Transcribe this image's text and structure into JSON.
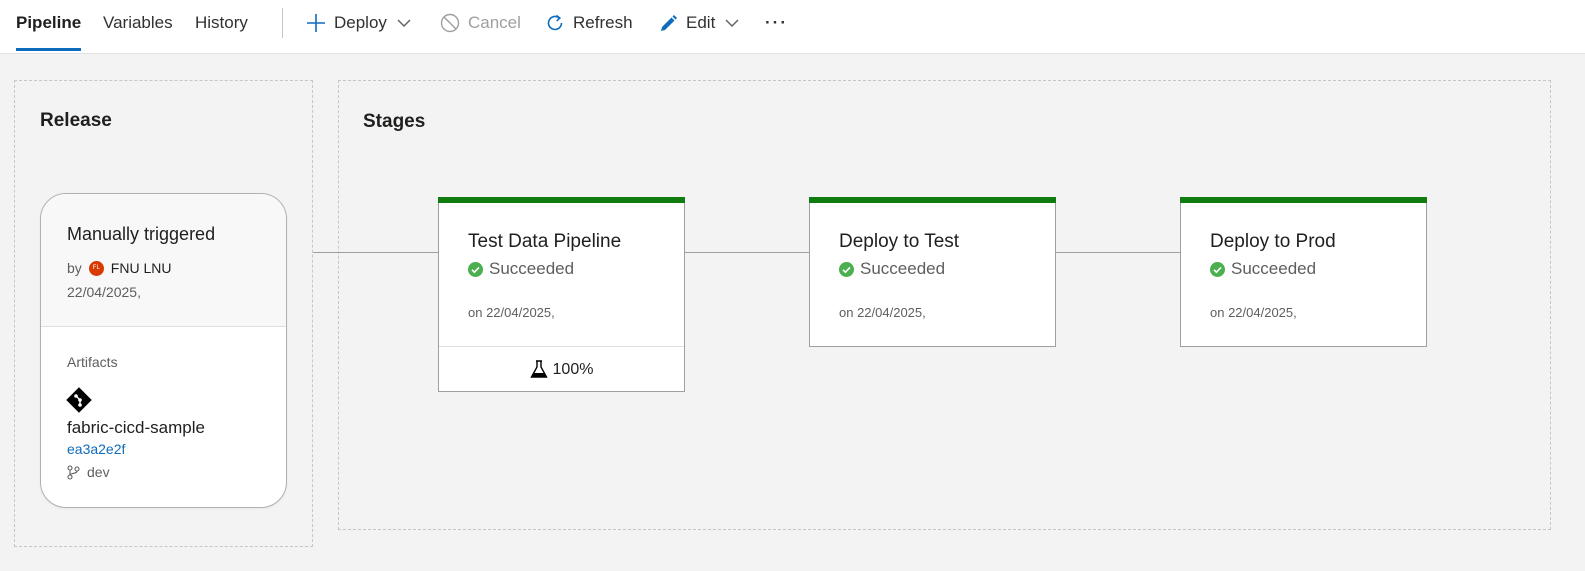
{
  "tabs": [
    {
      "label": "Pipeline",
      "active": true
    },
    {
      "label": "Variables",
      "active": false
    },
    {
      "label": "History",
      "active": false
    }
  ],
  "toolbar": {
    "deploy": {
      "label": "Deploy",
      "icon": "plus-icon"
    },
    "cancel": {
      "label": "Cancel",
      "icon": "cancel-icon",
      "disabled": true
    },
    "refresh": {
      "label": "Refresh",
      "icon": "refresh-icon"
    },
    "edit": {
      "label": "Edit",
      "icon": "pencil-icon"
    },
    "more": {
      "label": "···",
      "icon": "more-icon"
    }
  },
  "release": {
    "section_title": "Release",
    "trigger": "Manually triggered",
    "by_prefix": "by",
    "user": {
      "name": "FNU LNU",
      "initials": "FL",
      "avatar_color": "#d83b01"
    },
    "date": "22/04/2025,",
    "artifacts_label": "Artifacts",
    "artifact": {
      "name": "fabric-cicd-sample",
      "commit": "ea3a2e2f",
      "branch": "dev",
      "icon": "git-icon"
    }
  },
  "stages_section": {
    "title": "Stages"
  },
  "stages": [
    {
      "name": "Test Data Pipeline",
      "status": "Succeeded",
      "on": "on 22/04/2025,",
      "test_pass": "100%"
    },
    {
      "name": "Deploy to Test",
      "status": "Succeeded",
      "on": "on 22/04/2025,"
    },
    {
      "name": "Deploy to Prod",
      "status": "Succeeded",
      "on": "on 22/04/2025,"
    }
  ],
  "colors": {
    "success": "#107c10",
    "success_icon": "#4caf50",
    "accent": "#0f6cbd"
  }
}
